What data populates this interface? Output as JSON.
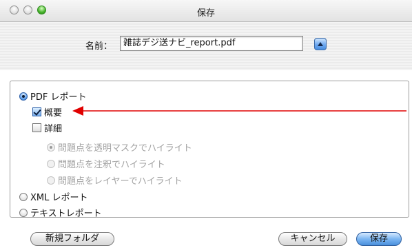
{
  "window": {
    "title": "保存"
  },
  "save_row": {
    "name_label": "名前：",
    "filename": "雑誌デジ送ナビ_report.pdf"
  },
  "options": {
    "pdf_report": "PDF レポート",
    "summary": "概要",
    "detail": "詳細",
    "highlight_transparent_mask": "問題点を透明マスクでハイライト",
    "highlight_annotation": "問題点を注釈でハイライト",
    "highlight_layer": "問題点をレイヤーでハイライト",
    "xml_report": "XML レポート",
    "text_report": "テキストレポート"
  },
  "states": {
    "report_type": "PDF レポート",
    "summary_checked": true,
    "detail_checked": false,
    "highlight_selected": "問題点を透明マスクでハイライト",
    "highlight_enabled": false
  },
  "buttons": {
    "new_folder": "新規フォルダ",
    "cancel": "キャンセル",
    "save": "保存"
  },
  "colors": {
    "annotation_arrow": "#e00000",
    "default_button": "#4a90dc"
  }
}
